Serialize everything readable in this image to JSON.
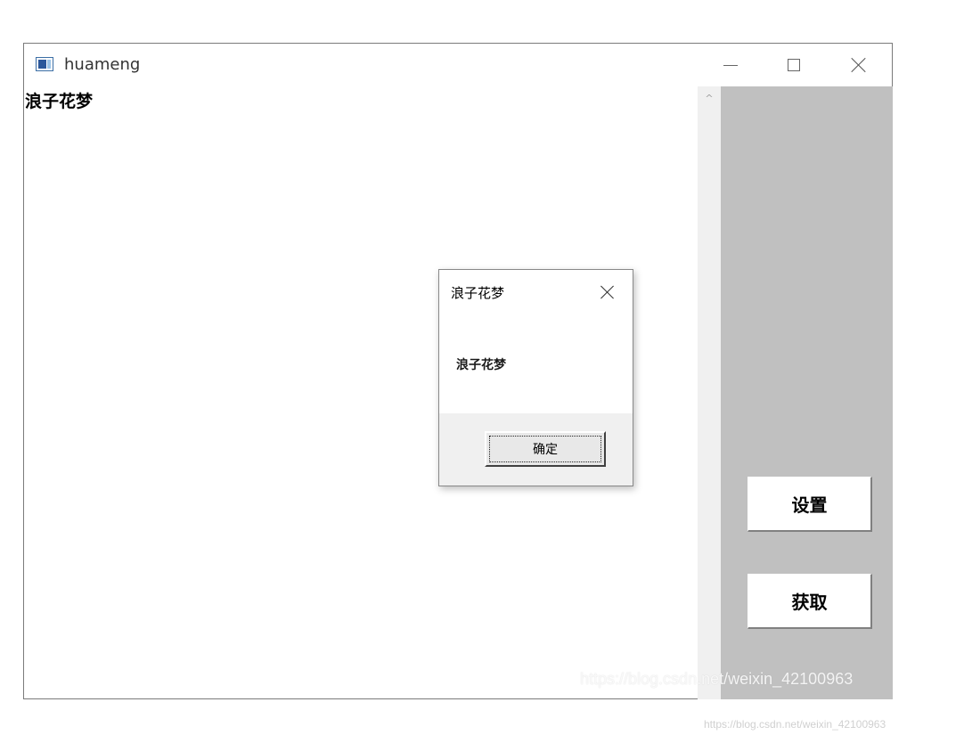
{
  "window": {
    "title": "huameng",
    "icon": "app-window-icon",
    "controls": {
      "minimize_icon": "minimize-icon",
      "maximize_icon": "maximize-icon",
      "close_icon": "close-icon"
    }
  },
  "main": {
    "label": "浪子花梦",
    "scroll_up_glyph": "^"
  },
  "side_panel": {
    "background_color": "#c0c0c0",
    "set_button_label": "设置",
    "get_button_label": "获取"
  },
  "dialog": {
    "title": "浪子花梦",
    "message": "浪子花梦",
    "ok_label": "确定",
    "close_icon": "close-icon"
  },
  "watermarks": {
    "inner": "https://blog.csdn.net/weixin_42100963",
    "outer": "https://blog.csdn.net/weixin_42100963"
  }
}
